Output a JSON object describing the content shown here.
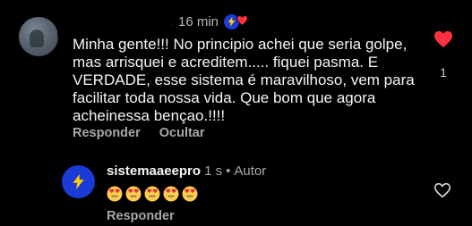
{
  "comment": {
    "timestamp": "16 min",
    "text": "Minha gente!!! No principio achei que seria golpe, mas arrisquei e acreditem..... fiquei pasma. E VERDADE, esse sistema é maravilhoso, vem para facilitar toda nossa vida. Que bom que agora acheinessa bençao.!!!!",
    "reply_label": "Responder",
    "hide_label": "Ocultar",
    "like_count": "1",
    "liked": true
  },
  "reply": {
    "username": "sistemaaeepro",
    "timestamp": "1 s",
    "separator": "•",
    "author_tag": "Autor",
    "emoji_count": 5,
    "emoji_name": "heart-eyes-emoji",
    "reply_label": "Responder",
    "liked": false
  },
  "colors": {
    "background": "#000000",
    "text": "#f5f5f5",
    "muted": "#a8a8a8",
    "like_red": "#ff3040",
    "badge_blue": "#1a3bd6"
  }
}
